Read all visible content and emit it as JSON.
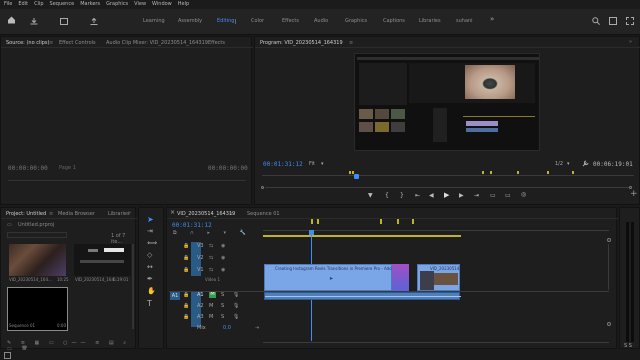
{
  "menu": [
    "File",
    "Edit",
    "Clip",
    "Sequence",
    "Markers",
    "Graphics",
    "View",
    "Window",
    "Help"
  ],
  "workspaces": [
    "Learning",
    "Assembly",
    "Editing",
    "Color",
    "Effects",
    "Audio",
    "Graphics",
    "Captions",
    "Libraries",
    "suhani"
  ],
  "active_workspace": "Editing",
  "source_panel": {
    "tabs": [
      "Source: (no clips)",
      "Effect Controls",
      "Audio Clip Mixer: VID_20230514_164319",
      "Effects"
    ],
    "timecode_left": "00:00:00:00",
    "page": "Page 1",
    "timecode_right": "00:00:00:00"
  },
  "program_panel": {
    "title": "Program: VID_20230514_164319",
    "timecode": "00:01:31:12",
    "fit": "Fit",
    "fraction": "1/2",
    "duration": "00:06:19:01"
  },
  "project_panel": {
    "tabs": [
      "Project: Untitled",
      "Media Browser",
      "Libraries"
    ],
    "file": "Untitled.prproj",
    "count": "1 of 7 ite...",
    "items": [
      {
        "name": "VID_20230514_164...",
        "duration": "10:25"
      },
      {
        "name": "VID_20230514_164...",
        "duration": "6:19:01"
      }
    ],
    "sequence": {
      "name": "Sequence 01",
      "duration": "0:00"
    }
  },
  "timeline": {
    "tabs": [
      "VID_20230514_164319",
      "Sequence 01"
    ],
    "timecode": "00:01:31:12",
    "video_tracks": [
      "V3",
      "V2",
      "V1"
    ],
    "video_label": "Video 1",
    "audio_tracks": [
      "A1",
      "A2",
      "A3"
    ],
    "mix_label": "Mix",
    "mix_value": "0.0",
    "src_v": "V1",
    "src_a": "A1",
    "clip1_label": "Creating Instagram Reels Transitions in Premiere Pro - Adobe Premi...",
    "clip2_label": "VID_20230514..."
  },
  "colors": {
    "accent": "#3d8ff5",
    "clip_video": "#7aa6e8",
    "clip_audio": "#4e7fb9"
  }
}
